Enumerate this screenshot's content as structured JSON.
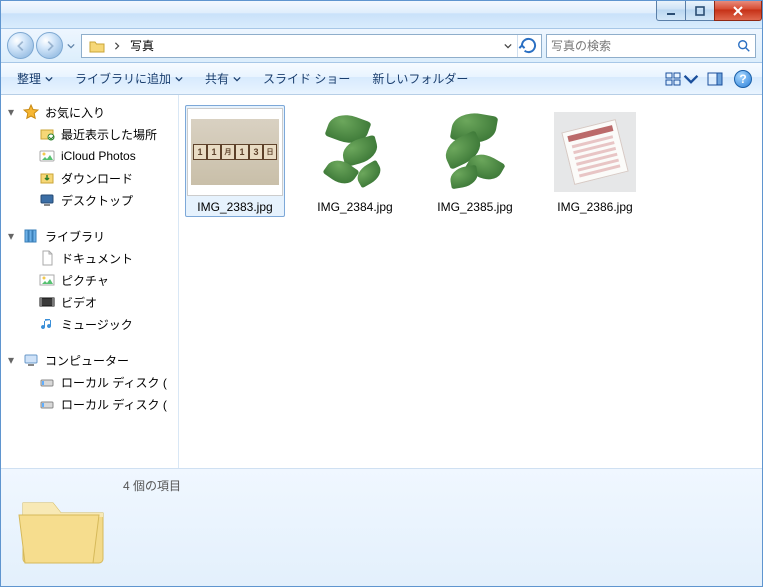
{
  "path": {
    "location": "写真"
  },
  "search": {
    "placeholder": "写真の検索"
  },
  "toolbar": {
    "organize": "整理",
    "addtolib": "ライブラリに追加",
    "share": "共有",
    "slideshow": "スライド ショー",
    "newfolder": "新しいフォルダー"
  },
  "sidebar": {
    "favorites": {
      "label": "お気に入り",
      "items": [
        {
          "label": "最近表示した場所",
          "icon": "recent"
        },
        {
          "label": "iCloud Photos",
          "icon": "icloud"
        },
        {
          "label": "ダウンロード",
          "icon": "download"
        },
        {
          "label": "デスクトップ",
          "icon": "desktop"
        }
      ]
    },
    "libraries": {
      "label": "ライブラリ",
      "items": [
        {
          "label": "ドキュメント",
          "icon": "doc"
        },
        {
          "label": "ピクチャ",
          "icon": "pic"
        },
        {
          "label": "ビデオ",
          "icon": "vid"
        },
        {
          "label": "ミュージック",
          "icon": "music"
        }
      ]
    },
    "computer": {
      "label": "コンピューター",
      "items": [
        {
          "label": "ローカル ディスク (",
          "icon": "disk"
        },
        {
          "label": "ローカル ディスク (",
          "icon": "disk"
        }
      ]
    }
  },
  "files": [
    {
      "name": "IMG_2383.jpg",
      "selected": true,
      "thumb": "cal"
    },
    {
      "name": "IMG_2384.jpg",
      "selected": false,
      "thumb": "plant1"
    },
    {
      "name": "IMG_2385.jpg",
      "selected": false,
      "thumb": "plant2"
    },
    {
      "name": "IMG_2386.jpg",
      "selected": false,
      "thumb": "note"
    }
  ],
  "status": {
    "count_text": "4 個の項目"
  }
}
